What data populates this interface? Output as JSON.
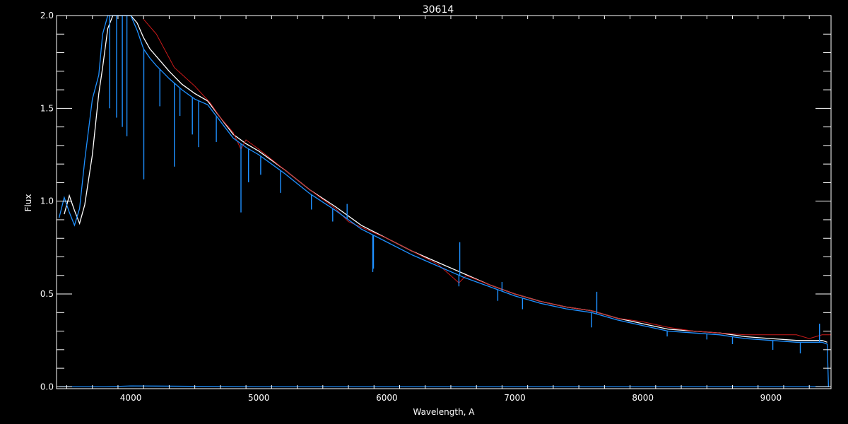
{
  "chart_data": {
    "type": "line",
    "title": "30614",
    "xlabel": "Wavelength, A",
    "ylabel": "Flux",
    "xlim": [
      3420,
      9470
    ],
    "ylim": [
      -0.01,
      2.0
    ],
    "x_ticks": [
      4000,
      5000,
      6000,
      7000,
      8000,
      9000
    ],
    "x_tick_labels": [
      "4000",
      "5000",
      "6000",
      "7000",
      "8000",
      "9000"
    ],
    "y_ticks": [
      0.0,
      0.5,
      1.0,
      1.5,
      2.0
    ],
    "y_tick_labels": [
      "0.0",
      "0.5",
      "1.0",
      "1.5",
      "2.0"
    ],
    "grid": false,
    "series": [
      {
        "color": "#ffffff",
        "x": [
          3480,
          3520,
          3560,
          3600,
          3640,
          3700,
          3750,
          3780,
          3820,
          3860,
          3900,
          3950,
          4000,
          4050,
          4100,
          4150,
          4200,
          4300,
          4400,
          4500,
          4600,
          4700,
          4800,
          4900,
          5000,
          5200,
          5400,
          5600,
          5800,
          6000,
          6200,
          6400,
          6600,
          6800,
          7000,
          7200,
          7400,
          7600,
          7800,
          8000,
          8200,
          8400,
          8600,
          8800,
          9000,
          9200,
          9400,
          9440
        ],
        "y": [
          0.93,
          1.03,
          0.95,
          0.88,
          0.98,
          1.25,
          1.58,
          1.72,
          1.93,
          2.0,
          2.0,
          2.0,
          2.0,
          1.96,
          1.88,
          1.82,
          1.78,
          1.7,
          1.63,
          1.58,
          1.54,
          1.45,
          1.36,
          1.31,
          1.27,
          1.17,
          1.06,
          0.97,
          0.87,
          0.8,
          0.73,
          0.67,
          0.61,
          0.55,
          0.5,
          0.46,
          0.43,
          0.41,
          0.37,
          0.34,
          0.31,
          0.3,
          0.29,
          0.27,
          0.26,
          0.25,
          0.25,
          0.24
        ]
      },
      {
        "color": "#cc1a1a",
        "x": [
          4100,
          4200,
          4340,
          4500,
          4620,
          4700,
          4800,
          4860,
          4900,
          5000,
          5200,
          5400,
          5600,
          5700,
          5800,
          6000,
          6200,
          6400,
          6563,
          6620,
          6800,
          7000,
          7200,
          7400,
          7600,
          7800,
          8000,
          8200,
          8400,
          8600,
          8800,
          9000,
          9200,
          9300,
          9400,
          9470
        ],
        "y": [
          1.98,
          1.9,
          1.72,
          1.62,
          1.53,
          1.45,
          1.37,
          1.28,
          1.33,
          1.28,
          1.17,
          1.06,
          0.96,
          0.89,
          0.86,
          0.8,
          0.73,
          0.66,
          0.56,
          0.6,
          0.55,
          0.5,
          0.46,
          0.43,
          0.41,
          0.37,
          0.35,
          0.32,
          0.3,
          0.29,
          0.28,
          0.28,
          0.28,
          0.26,
          0.28,
          0.28
        ]
      },
      {
        "color": "#1e90ff",
        "x": [
          3440,
          3480,
          3520,
          3560,
          3600,
          3640,
          3700,
          3750,
          3780,
          3820,
          3860,
          3900,
          3950,
          4000,
          4050,
          4100,
          4150,
          4200,
          4300,
          4400,
          4500,
          4600,
          4700,
          4800,
          4900,
          5000,
          5200,
          5400,
          5600,
          5800,
          6000,
          6200,
          6400,
          6600,
          6800,
          7000,
          7200,
          7400,
          7600,
          7800,
          8000,
          8200,
          8400,
          8600,
          8800,
          9000,
          9200,
          9400,
          9440,
          9450
        ],
        "y": [
          0.91,
          1.02,
          0.94,
          0.87,
          0.96,
          1.22,
          1.55,
          1.68,
          1.9,
          2.0,
          2.0,
          2.0,
          2.0,
          2.0,
          1.92,
          1.82,
          1.77,
          1.73,
          1.66,
          1.6,
          1.55,
          1.52,
          1.43,
          1.34,
          1.29,
          1.25,
          1.15,
          1.04,
          0.95,
          0.85,
          0.78,
          0.71,
          0.65,
          0.59,
          0.54,
          0.49,
          0.45,
          0.42,
          0.4,
          0.36,
          0.33,
          0.3,
          0.29,
          0.28,
          0.26,
          0.25,
          0.24,
          0.24,
          0.23,
          0.0
        ]
      },
      {
        "color": "#1e90ff",
        "x": [
          3440,
          3800,
          4000,
          4200,
          5000,
          6000,
          7000,
          8000,
          9000,
          9450
        ],
        "y": [
          0.0,
          0.0,
          0.005,
          0.004,
          0.0,
          0.0,
          0.0,
          0.0,
          0.0,
          0.0
        ]
      }
    ],
    "absorption_features": [
      {
        "x": 3835,
        "depth": 0.5
      },
      {
        "x": 3889,
        "depth": 0.55
      },
      {
        "x": 3934,
        "depth": 0.6
      },
      {
        "x": 3970,
        "depth": 0.65
      },
      {
        "x": 4102,
        "depth": 0.7
      },
      {
        "x": 4227,
        "depth": 0.2
      },
      {
        "x": 4340,
        "depth": 0.45
      },
      {
        "x": 4384,
        "depth": 0.15
      },
      {
        "x": 4481,
        "depth": 0.2
      },
      {
        "x": 4530,
        "depth": 0.25
      },
      {
        "x": 4668,
        "depth": 0.14
      },
      {
        "x": 4861,
        "depth": 0.37
      },
      {
        "x": 4920,
        "depth": 0.18
      },
      {
        "x": 5015,
        "depth": 0.1
      },
      {
        "x": 5170,
        "depth": 0.12
      },
      {
        "x": 5411,
        "depth": 0.08
      },
      {
        "x": 5577,
        "depth": 0.07
      },
      {
        "x": 5890,
        "depth": 0.2
      },
      {
        "x": 5896,
        "depth": 0.18
      },
      {
        "x": 6563,
        "depth": 0.06
      },
      {
        "x": 6867,
        "depth": 0.06
      },
      {
        "x": 7060,
        "depth": 0.06
      },
      {
        "x": 7600,
        "depth": 0.08
      },
      {
        "x": 8190,
        "depth": 0.03
      },
      {
        "x": 8500,
        "depth": 0.03
      },
      {
        "x": 8700,
        "depth": 0.04
      },
      {
        "x": 9015,
        "depth": 0.05
      },
      {
        "x": 9230,
        "depth": 0.06
      }
    ],
    "emission_features": [
      {
        "x": 5690,
        "height": 0.08
      },
      {
        "x": 6570,
        "height": 0.18
      },
      {
        "x": 6900,
        "height": 0.05
      },
      {
        "x": 7640,
        "height": 0.12
      },
      {
        "x": 9380,
        "height": 0.1
      }
    ]
  }
}
